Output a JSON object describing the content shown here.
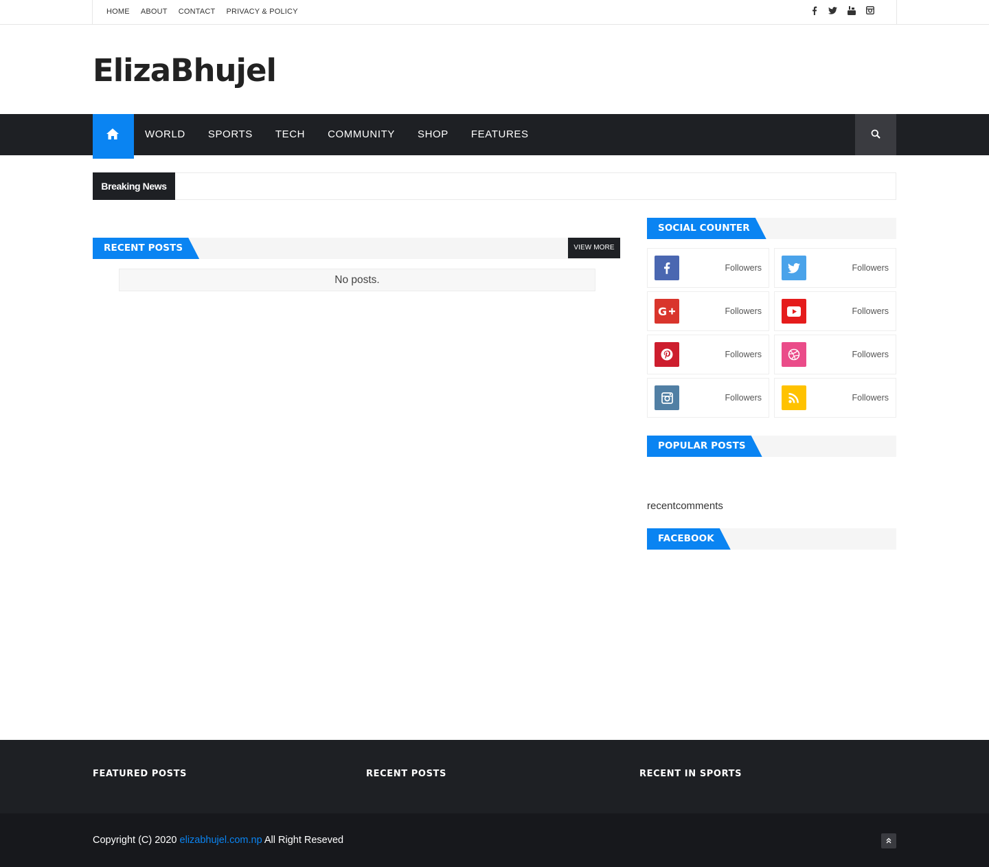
{
  "topbar": {
    "links": [
      "HOME",
      "ABOUT",
      "CONTACT",
      "PRIVACY & POLICY"
    ],
    "social_icons": [
      "facebook-icon",
      "twitter-icon",
      "youtube-icon",
      "instagram-icon"
    ]
  },
  "header": {
    "logo": "ElizaBhujel"
  },
  "nav": {
    "items": [
      "WORLD",
      "SPORTS",
      "TECH",
      "COMMUNITY",
      "SHOP",
      "FEATURES"
    ],
    "accent": "#0a84f2",
    "bar_color": "#1e2024"
  },
  "ticker": {
    "label": "Breaking News"
  },
  "main": {
    "recent_posts_title": "RECENT POSTS",
    "view_more": "VIEW MORE",
    "empty_text": "No posts."
  },
  "sidebar": {
    "social_title": "SOCIAL COUNTER",
    "social": [
      {
        "icon": "facebook-icon",
        "label": "Followers",
        "color": "#4a67b1"
      },
      {
        "icon": "twitter-icon",
        "label": "Followers",
        "color": "#4aa3ea"
      },
      {
        "icon": "google-plus-icon",
        "label": "Followers",
        "color": "#d9352c"
      },
      {
        "icon": "youtube-icon",
        "label": "Followers",
        "color": "#e51c1c"
      },
      {
        "icon": "pinterest-icon",
        "label": "Followers",
        "color": "#cd1e2e"
      },
      {
        "icon": "dribbble-icon",
        "label": "Followers",
        "color": "#ea4c89"
      },
      {
        "icon": "instagram-icon",
        "label": "Followers",
        "color": "#517fa4"
      },
      {
        "icon": "rss-icon",
        "label": "Followers",
        "color": "#ffc200"
      }
    ],
    "popular_title": "POPULAR POSTS",
    "recentcomments": "recentcomments",
    "facebook_title": "FACEBOOK"
  },
  "footer": {
    "columns": [
      "FEATURED POSTS",
      "RECENT POSTS",
      "RECENT IN SPORTS"
    ],
    "copyright_prefix": "Copyright (C) 2020",
    "copyright_link": "elizabhujel.com.np",
    "copyright_suffix": "All Right Reseved"
  }
}
